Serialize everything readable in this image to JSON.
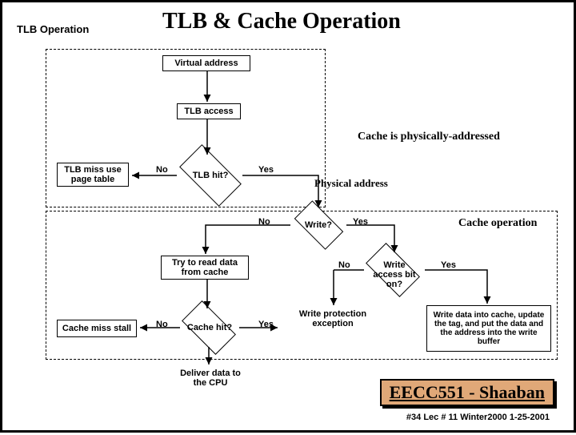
{
  "title": "TLB & Cache Operation",
  "side_label": "TLB Operation",
  "nodes": {
    "virtual_addr": "Virtual address",
    "tlb_access": "TLB access",
    "tlb_miss": "TLB miss use page table",
    "tlb_hit": "TLB hit?",
    "phys_addr": "Physical address",
    "write_q": "Write?",
    "try_read": "Try to read data from cache",
    "write_access": "Write access bit on?",
    "cache_miss": "Cache miss stall",
    "cache_hit": "Cache hit?",
    "write_prot": "Write protection exception",
    "write_data": "Write data into cache, update the tag, and put the data and the address into the write buffer",
    "deliver": "Deliver data to the CPU"
  },
  "labels": {
    "no": "No",
    "yes": "Yes",
    "cache_phys": "Cache is physically-addressed",
    "cache_op": "Cache operation"
  },
  "footer": {
    "course": "EECC551 - Shaaban",
    "meta": "#34  Lec # 11  Winter2000  1-25-2001"
  }
}
